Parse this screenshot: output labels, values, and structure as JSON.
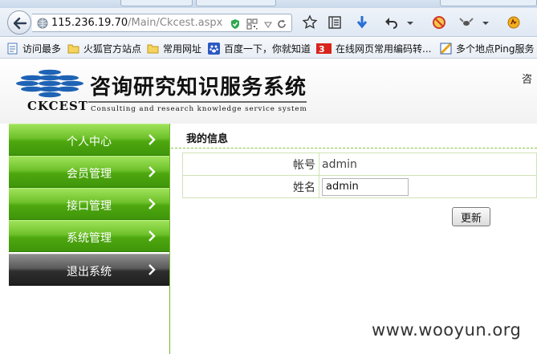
{
  "browser": {
    "url_host": "115.236.19.70",
    "url_path": "/Main/Ckcest.aspx",
    "bookmarks": [
      {
        "label": "访问最多",
        "icon": "page-icon"
      },
      {
        "label": "火狐官方站点",
        "icon": "folder-icon"
      },
      {
        "label": "常用网址",
        "icon": "folder-icon"
      },
      {
        "label": "百度一下，你就知道",
        "icon": "baidu-paw-icon"
      },
      {
        "label": "在线网页常用编码转...",
        "icon": "code-site-icon"
      },
      {
        "label": "多个地点Ping服务",
        "icon": "ping-site-icon"
      }
    ]
  },
  "header": {
    "logo_text": "CKCEST",
    "title": "咨询研究知识服务系统",
    "subtitle": "Consulting and research knowledge service system",
    "right_text": "咨"
  },
  "sidebar": {
    "items": [
      {
        "label": "个人中心"
      },
      {
        "label": "会员管理"
      },
      {
        "label": "接口管理"
      },
      {
        "label": "系统管理"
      },
      {
        "label": "退出系统"
      }
    ]
  },
  "content": {
    "title": "我的信息",
    "rows": [
      {
        "label": "帐号",
        "value": "admin"
      },
      {
        "label": "姓名",
        "value": "admin"
      }
    ],
    "update_button": "更新"
  },
  "watermark": "www.wooyun.org",
  "colors": {
    "menu_green": "#5cb51a",
    "menu_dark": "#3a3a3a",
    "rule_green": "#8cc43f"
  }
}
